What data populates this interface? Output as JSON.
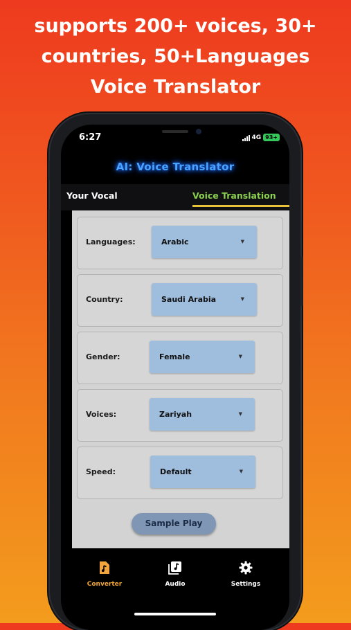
{
  "banner": {
    "line1": "supports 200+ voices, 30+",
    "line2": "countries, 50+Languages",
    "line3": "Voice Translator"
  },
  "status_bar": {
    "time": "6:27",
    "network": "4G",
    "battery": "93+"
  },
  "app": {
    "title": "AI: Voice Translator",
    "tabs": [
      {
        "label": "Your Vocal",
        "active": false
      },
      {
        "label": "Voice Translation",
        "active": true
      }
    ],
    "fields": [
      {
        "label": "Languages:",
        "value": "Arabic"
      },
      {
        "label": "Country:",
        "value": "Saudi Arabia"
      },
      {
        "label": "Gender:",
        "value": "Female"
      },
      {
        "label": "Voices:",
        "value": "Zariyah"
      },
      {
        "label": "Speed:",
        "value": "Default"
      }
    ],
    "sample_button": "Sample Play",
    "bottom_nav": [
      {
        "label": "Converter",
        "icon": "music-file-icon",
        "active": true
      },
      {
        "label": "Audio",
        "icon": "music-library-icon",
        "active": false
      },
      {
        "label": "Settings",
        "icon": "gear-icon",
        "active": false
      }
    ]
  },
  "colors": {
    "accent_active_nav": "#f2a53a",
    "tab_active": "#8bd04e",
    "tab_underline": "#e7c23a",
    "title_glow": "#4aa3ff",
    "dropdown_bg": "#9fbede",
    "button_bg": "#7f97b5"
  },
  "dropdown_arrow": "▼"
}
